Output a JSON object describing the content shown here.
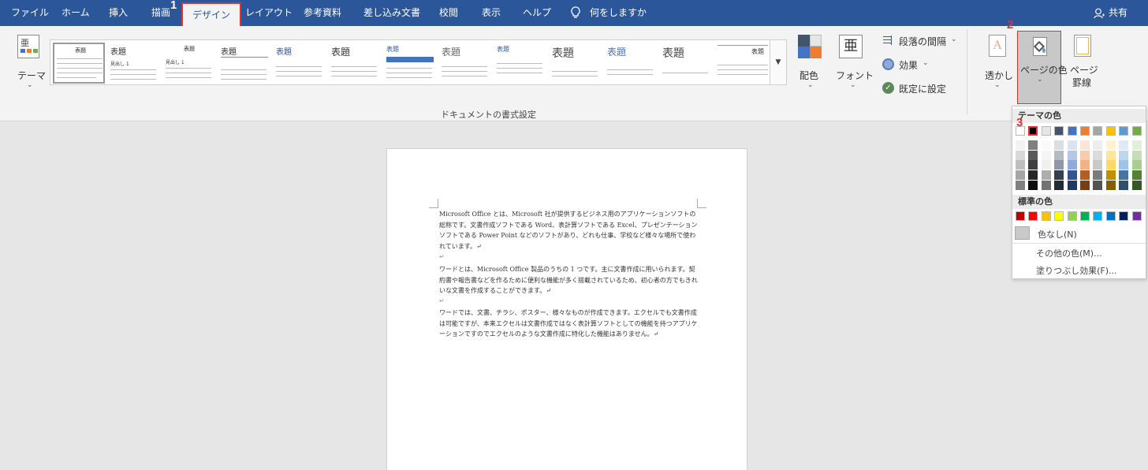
{
  "tabs": [
    "ファイル",
    "ホーム",
    "挿入",
    "描画",
    "デザイン",
    "レイアウト",
    "参考資料",
    "差し込み文書",
    "校閲",
    "表示",
    "ヘルプ"
  ],
  "tell_me": "何をしますか",
  "share": "共有",
  "markers": [
    "1",
    "2",
    "3"
  ],
  "ribbon": {
    "theme_label": "テーマ",
    "gallery_titles": [
      "表題",
      "表題",
      "表題",
      "表題",
      "表題",
      "表題",
      "表題",
      "表題",
      "表題",
      "表題",
      "表題",
      "表題",
      "表題"
    ],
    "gallery_heading": "見出し 1",
    "colors_label": "配色",
    "fonts_label": "フォント",
    "fonts_glyph": "亜",
    "paragraph_spacing": "段落の間隔",
    "effects": "効果",
    "set_default": "既定に設定",
    "group_label": "ドキュメントの書式設定",
    "watermark": "透かし",
    "page_color": "ページの色",
    "page_borders_line1": "ページ",
    "page_borders_line2": "罫線"
  },
  "document": {
    "paragraphs": [
      "Microsoft Office とは、Microsoft 社が提供するビジネス用のアプリケーションソフトの総称です。文書作成ソフトである Word、表計算ソフトである Excel、プレゼンテーションソフトである Power Point などのソフトがあり、どれも仕事、学校など様々な場所で使われています。↵",
      "ワードとは、Microsoft Office 製品のうちの 1 つです。主に文書作成に用いられます。契約書や報告書などを作るために便利な機能が多く搭載されているため、初心者の方でもきれいな文書を作成することができます。↵",
      "ワードでは、文書、チラシ、ポスター、様々なものが作成できます。エクセルでも文書作成は可能ですが、本来エクセルは文書作成ではなく表計算ソフトとしての機能を持つアプリケーションですのでエクセルのような文書作成に特化した機能はありません。↵"
    ],
    "empty_mark": "↵"
  },
  "dropdown": {
    "theme_colors_header": "テーマの色",
    "standard_colors_header": "標準の色",
    "no_color": "色なし(N)",
    "more_colors": "その他の色(M)...",
    "fill_effects": "塗りつぶし効果(F)...",
    "theme_colors": [
      "#ffffff",
      "#000000",
      "#e7e6e6",
      "#44546a",
      "#4472c4",
      "#ed7d31",
      "#a5a5a5",
      "#ffc000",
      "#5b9bd5",
      "#70ad47"
    ],
    "standard_colors": [
      "#c00000",
      "#ff0000",
      "#ffc000",
      "#ffff00",
      "#92d050",
      "#00b050",
      "#00b0f0",
      "#0070c0",
      "#002060",
      "#7030a0"
    ]
  }
}
